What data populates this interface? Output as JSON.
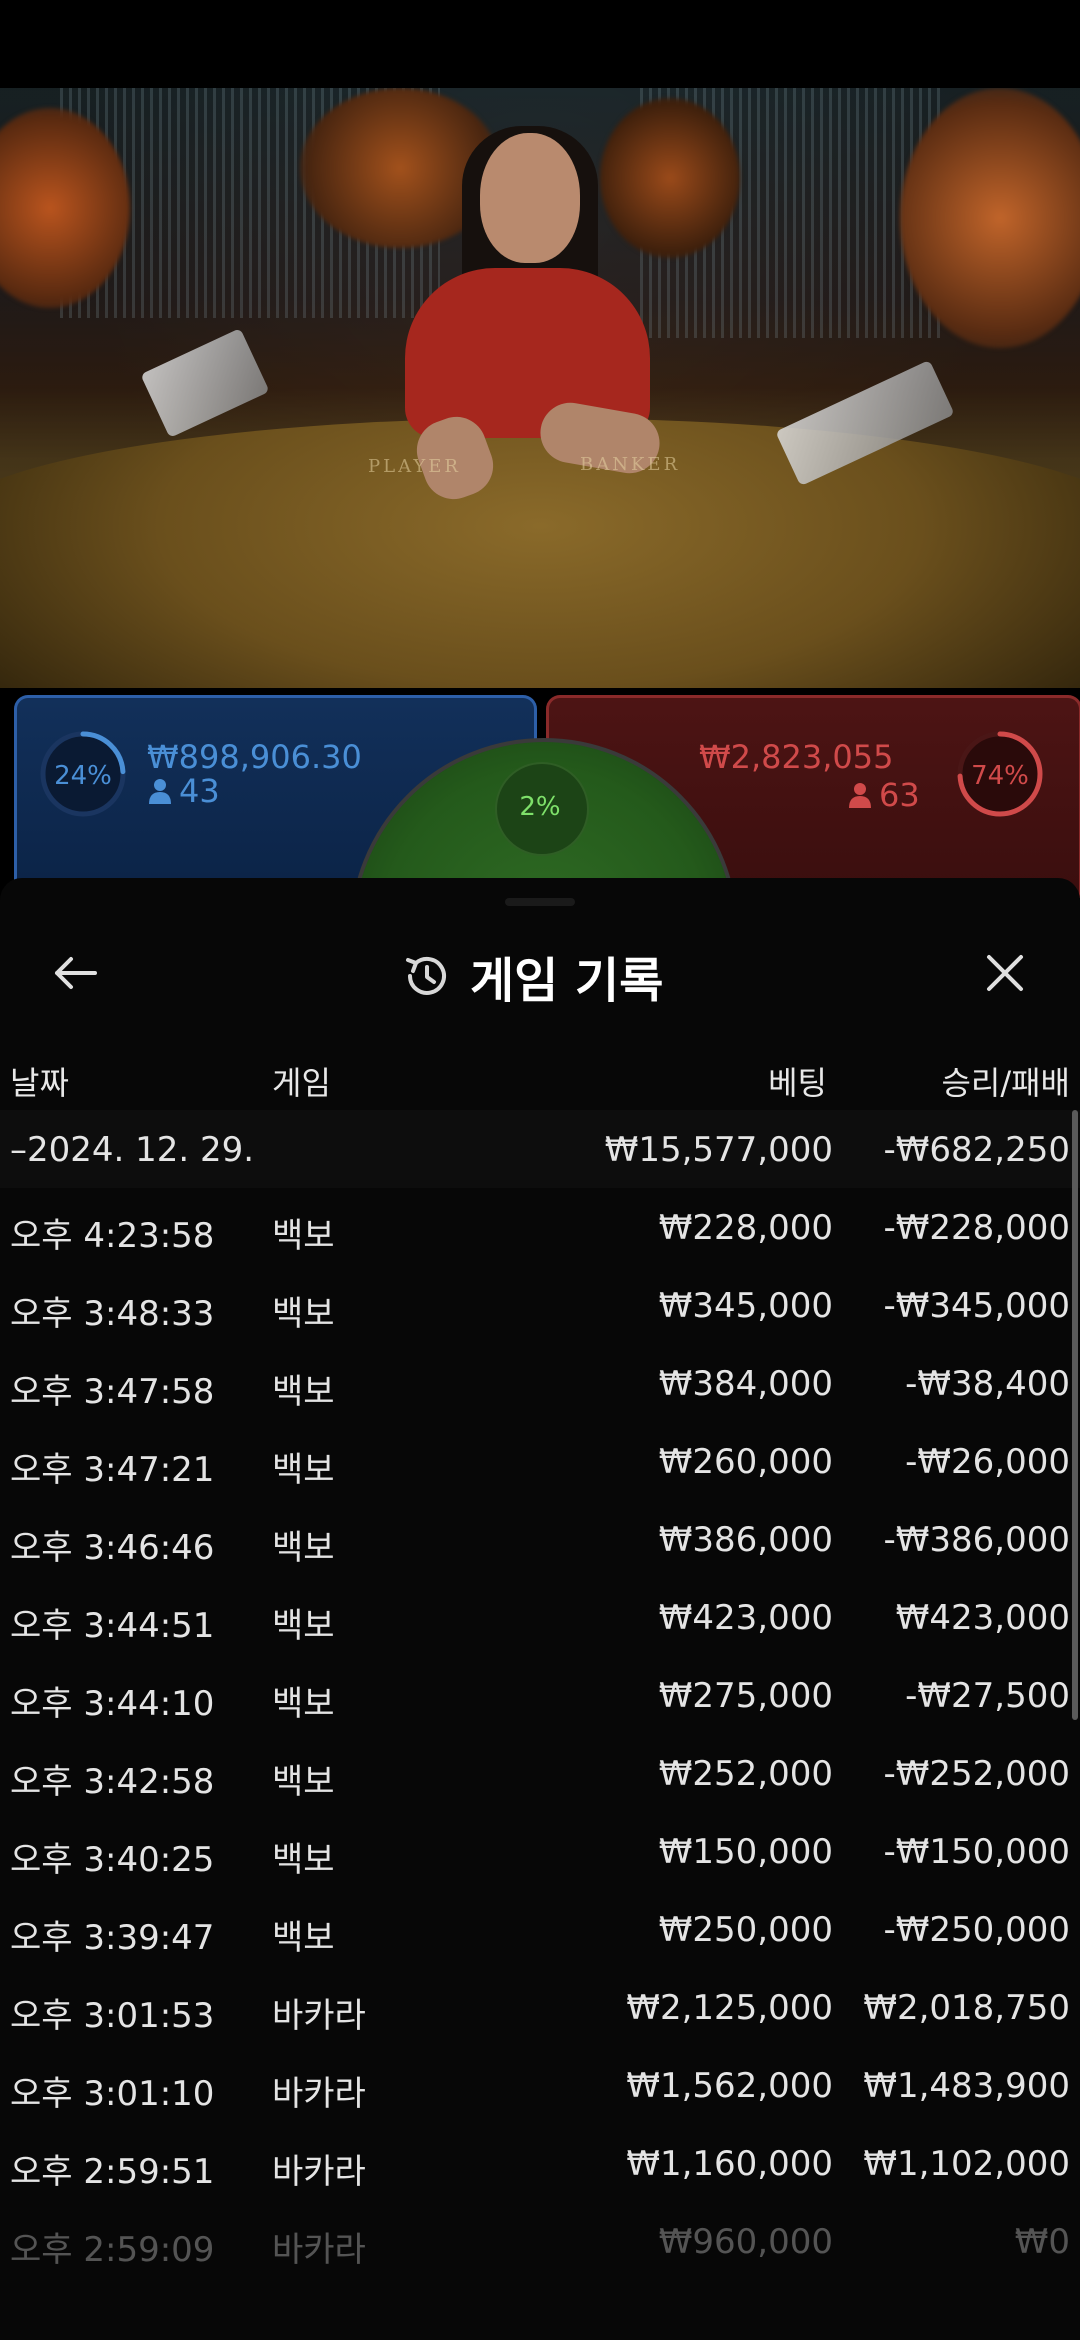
{
  "video": {
    "felt_left_label": "PLAYER",
    "felt_right_label": "BANKER"
  },
  "player": {
    "percent": "24%",
    "percent_value": 24,
    "amount": "₩898,906.30",
    "count": "43",
    "color": "#4a8fd6"
  },
  "banker": {
    "percent": "74%",
    "percent_value": 74,
    "amount": "₩2,823,055",
    "count": "63",
    "color": "#d04a4a"
  },
  "tie": {
    "percent": "2%",
    "color": "#6fd457"
  },
  "sheet": {
    "title": "게임 기록",
    "back_icon": "arrow-left-icon",
    "history_icon": "history-icon",
    "close_icon": "close-icon",
    "columns": {
      "date": "날짜",
      "game": "게임",
      "bet": "베팅",
      "result": "승리/패배"
    },
    "day_row": {
      "date": "–2024. 12. 29.",
      "bet": "₩15,577,000",
      "result": "-₩682,250"
    },
    "rows": [
      {
        "time": "오후 4:23:58",
        "game": "백보",
        "bet": "₩228,000",
        "result": "-₩228,000"
      },
      {
        "time": "오후 3:48:33",
        "game": "백보",
        "bet": "₩345,000",
        "result": "-₩345,000"
      },
      {
        "time": "오후 3:47:58",
        "game": "백보",
        "bet": "₩384,000",
        "result": "-₩38,400"
      },
      {
        "time": "오후 3:47:21",
        "game": "백보",
        "bet": "₩260,000",
        "result": "-₩26,000"
      },
      {
        "time": "오후 3:46:46",
        "game": "백보",
        "bet": "₩386,000",
        "result": "-₩386,000"
      },
      {
        "time": "오후 3:44:51",
        "game": "백보",
        "bet": "₩423,000",
        "result": "₩423,000"
      },
      {
        "time": "오후 3:44:10",
        "game": "백보",
        "bet": "₩275,000",
        "result": "-₩27,500"
      },
      {
        "time": "오후 3:42:58",
        "game": "백보",
        "bet": "₩252,000",
        "result": "-₩252,000"
      },
      {
        "time": "오후 3:40:25",
        "game": "백보",
        "bet": "₩150,000",
        "result": "-₩150,000"
      },
      {
        "time": "오후 3:39:47",
        "game": "백보",
        "bet": "₩250,000",
        "result": "-₩250,000"
      },
      {
        "time": "오후 3:01:53",
        "game": "바카라",
        "bet": "₩2,125,000",
        "result": "₩2,018,750"
      },
      {
        "time": "오후 3:01:10",
        "game": "바카라",
        "bet": "₩1,562,000",
        "result": "₩1,483,900"
      },
      {
        "time": "오후 2:59:51",
        "game": "바카라",
        "bet": "₩1,160,000",
        "result": "₩1,102,000"
      },
      {
        "time": "오후 2:59:09",
        "game": "바카라",
        "bet": "₩960,000",
        "result": "₩0"
      }
    ]
  }
}
